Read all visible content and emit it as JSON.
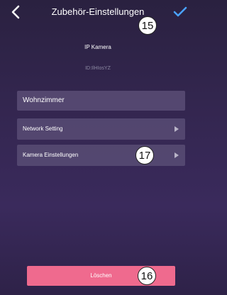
{
  "header": {
    "title": "Zubehör-Einstellungen"
  },
  "device": {
    "name": "IP Kamera",
    "id": "ID:IlHIosYZ"
  },
  "room_field": {
    "value": "Wohnzimmer"
  },
  "menu": {
    "items": [
      {
        "label": "Network Setting",
        "icon": "chevron-right-icon"
      },
      {
        "label": "Kamera Einstellungen",
        "icon": "chevron-right-icon"
      }
    ]
  },
  "actions": {
    "delete_label": "Löschen"
  },
  "callouts": {
    "title": "15",
    "camera_settings": "17",
    "delete": "16"
  },
  "colors": {
    "background_top": "#2a2140",
    "background_bottom": "#3a2a5c",
    "delete_button": "#ef6a8e",
    "confirm_check": "#4aa3ff"
  }
}
